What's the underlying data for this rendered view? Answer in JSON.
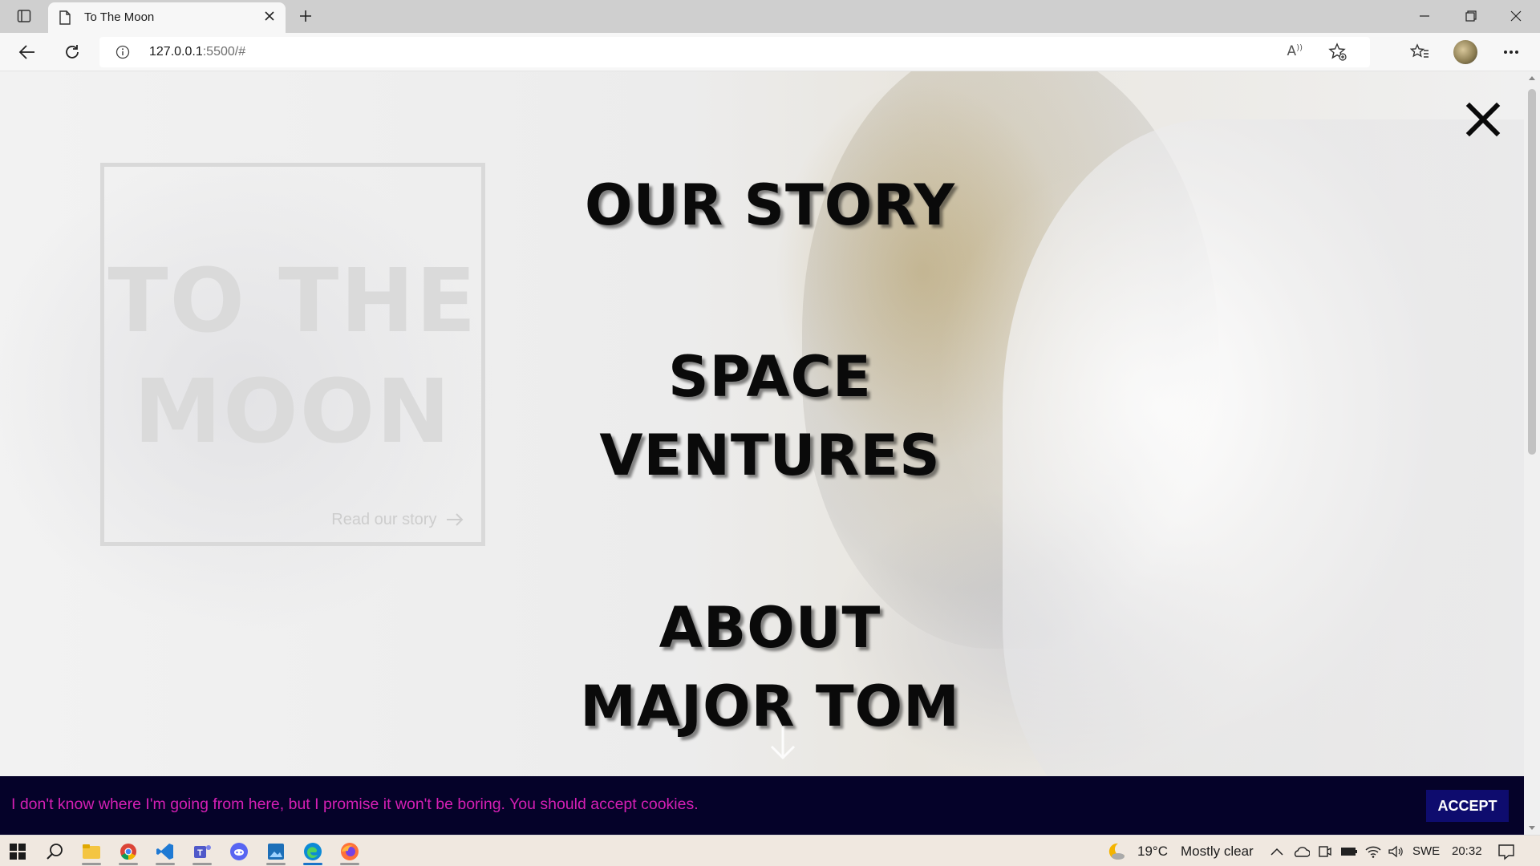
{
  "browser": {
    "tab_title": "To The Moon",
    "url_host": "127.0.0.1",
    "url_rest": ":5500/#"
  },
  "page": {
    "card": {
      "title_line1": "TO THE",
      "title_line2": "MOON",
      "link": "Read our story"
    },
    "menu": {
      "items": [
        {
          "line1": "OUR STORY",
          "line2": ""
        },
        {
          "line1": "SPACE",
          "line2": "VENTURES"
        },
        {
          "line1": "ABOUT",
          "line2": "MAJOR TOM"
        }
      ]
    },
    "cookie": {
      "message": "I don't know where I'm going from here, but I promise it won't be boring. You should accept cookies.",
      "accept": "ACCEPT"
    },
    "colors": {
      "cookie_bg": "#050229",
      "cookie_text": "#d51fb4",
      "accept_bg": "#0e0c6e"
    }
  },
  "taskbar": {
    "weather_temp": "19°C",
    "weather_desc": "Mostly clear",
    "language": "SWE",
    "time": "20:32"
  }
}
